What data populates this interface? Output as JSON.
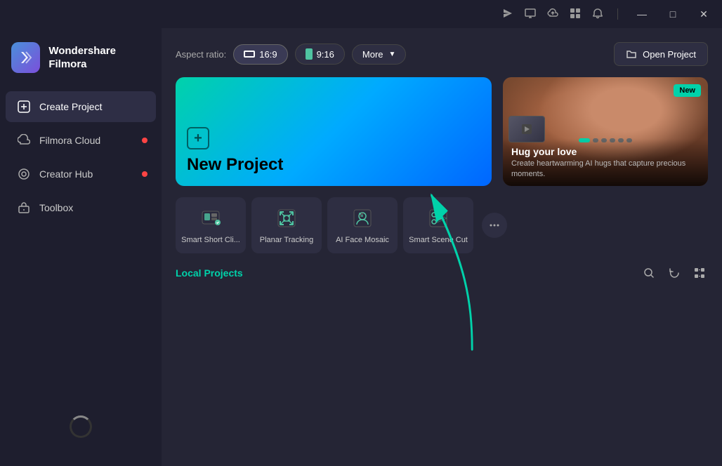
{
  "titlebar": {
    "icons": [
      "send-icon",
      "monitor-icon",
      "cloud-icon",
      "grid-icon",
      "bell-icon"
    ],
    "buttons": [
      "minimize",
      "maximize",
      "close"
    ]
  },
  "sidebar": {
    "logo_name": "Wondershare\nFilmora",
    "items": [
      {
        "id": "create-project",
        "label": "Create Project",
        "active": true,
        "dot": false
      },
      {
        "id": "filmora-cloud",
        "label": "Filmora Cloud",
        "active": false,
        "dot": true
      },
      {
        "id": "creator-hub",
        "label": "Creator Hub",
        "active": false,
        "dot": true
      },
      {
        "id": "toolbox",
        "label": "Toolbox",
        "active": false,
        "dot": false
      }
    ]
  },
  "topbar": {
    "aspect_label": "Aspect ratio:",
    "aspect_options": [
      {
        "label": "16:9",
        "icon": "landscape",
        "active": true
      },
      {
        "label": "9:16",
        "icon": "portrait",
        "active": false
      }
    ],
    "more_label": "More",
    "open_project_label": "Open Project"
  },
  "new_project": {
    "title": "New Project"
  },
  "featured": {
    "badge": "New",
    "title": "Hug your love",
    "desc": "Create heartwarming AI hugs that capture\nprecious moments.",
    "dots": 6,
    "active_dot": 0
  },
  "tools": [
    {
      "id": "smart-short-clip",
      "label": "Smart Short Cli...",
      "icon": "film-clip-icon"
    },
    {
      "id": "planar-tracking",
      "label": "Planar Tracking",
      "icon": "tracking-icon"
    },
    {
      "id": "ai-face-mosaic",
      "label": "AI Face Mosaic",
      "icon": "mosaic-icon"
    },
    {
      "id": "smart-scene-cut",
      "label": "Smart Scene Cut",
      "icon": "scissors-icon"
    }
  ],
  "local_projects": {
    "title": "Local Projects",
    "icons": [
      "search-icon",
      "refresh-icon",
      "grid-view-icon"
    ]
  },
  "colors": {
    "accent": "#00d2aa",
    "sidebar_bg": "#1e1e2e",
    "main_bg": "#252535"
  }
}
